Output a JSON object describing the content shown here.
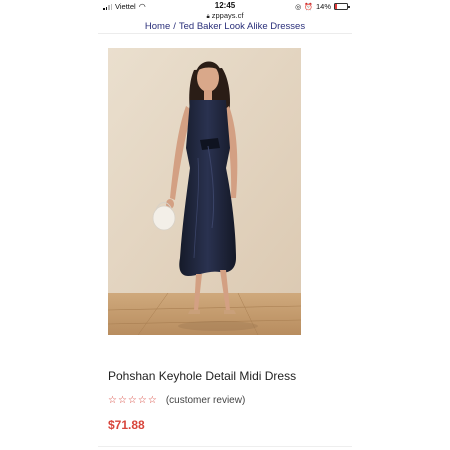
{
  "status_bar": {
    "carrier": "Viettel",
    "time": "12:45",
    "battery": "14%",
    "signal_icon": "signal-icon",
    "wifi_icon": "wifi-icon"
  },
  "browser": {
    "url": "zppays.cf"
  },
  "breadcrumb": {
    "home": "Home",
    "separator": "/",
    "current": "Ted Baker Look Alike Dresses"
  },
  "product": {
    "title": "Pohshan Keyhole Detail Midi Dress",
    "stars": "☆☆☆☆☆",
    "review_text": "(customer review)",
    "price": "$71.88"
  },
  "colors": {
    "accent": "#d8453b",
    "breadcrumb_link": "#2a2f7a",
    "dress": "#1e2436",
    "background_wall": "#e6d8c6",
    "floor": "#c9a47a"
  }
}
